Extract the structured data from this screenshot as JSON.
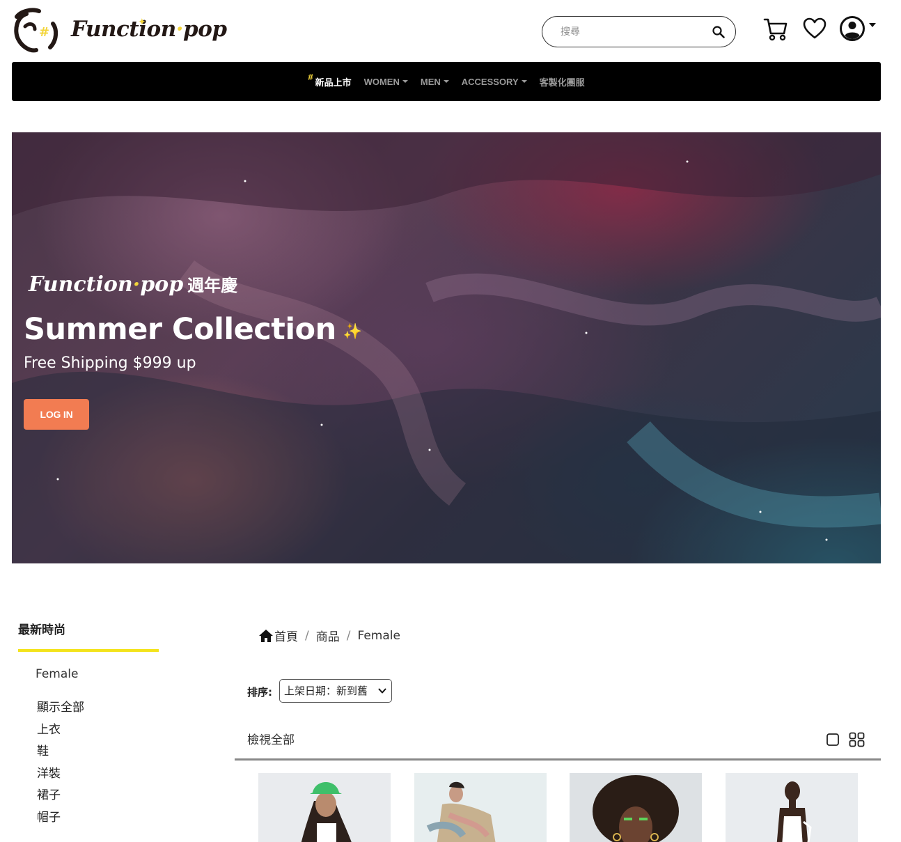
{
  "brand": {
    "logo_text": "Function",
    "logo_dot": "·",
    "logo_suffix": "pop",
    "hash_glyph": "#"
  },
  "header": {
    "search": {
      "placeholder": "搜尋",
      "value": ""
    },
    "icons": [
      "search-icon",
      "cart-icon",
      "heart-icon",
      "user-icon",
      "caret-down-icon"
    ]
  },
  "nav": {
    "items": [
      {
        "label": "新品上市",
        "active": true,
        "hash": "#"
      },
      {
        "label": "WOMEN",
        "dropdown": true
      },
      {
        "label": "MEN",
        "dropdown": true
      },
      {
        "label": "ACCESSORY",
        "dropdown": true
      },
      {
        "label": "客製化團服"
      }
    ]
  },
  "hero": {
    "brand_logo": "Function",
    "brand_dot": "·",
    "brand_logo_suffix": "pop",
    "brand_suffix": "週年慶",
    "title": "Summer Collection",
    "sparkle": "✨",
    "subtitle": "Free Shipping $999 up",
    "button_label": "LOG IN"
  },
  "sidebar": {
    "title": "最新時尚",
    "category": "Female",
    "links": [
      "顯示全部",
      "上衣",
      "鞋",
      "洋裝",
      "裙子",
      "帽子"
    ]
  },
  "breadcrumb": {
    "items": [
      "首頁",
      "商品",
      "Female"
    ],
    "separator": "/"
  },
  "sort": {
    "label": "排序:",
    "selected": "上架日期：新到舊"
  },
  "listing": {
    "view_all_label": "檢視全部",
    "view_icons": [
      "single-view-icon",
      "grid-view-icon"
    ]
  },
  "colors": {
    "accent_yellow": "#f3d53b",
    "button_orange": "#f27c52",
    "nav_bg": "#000000",
    "underline_yellow": "#f3e31c"
  }
}
